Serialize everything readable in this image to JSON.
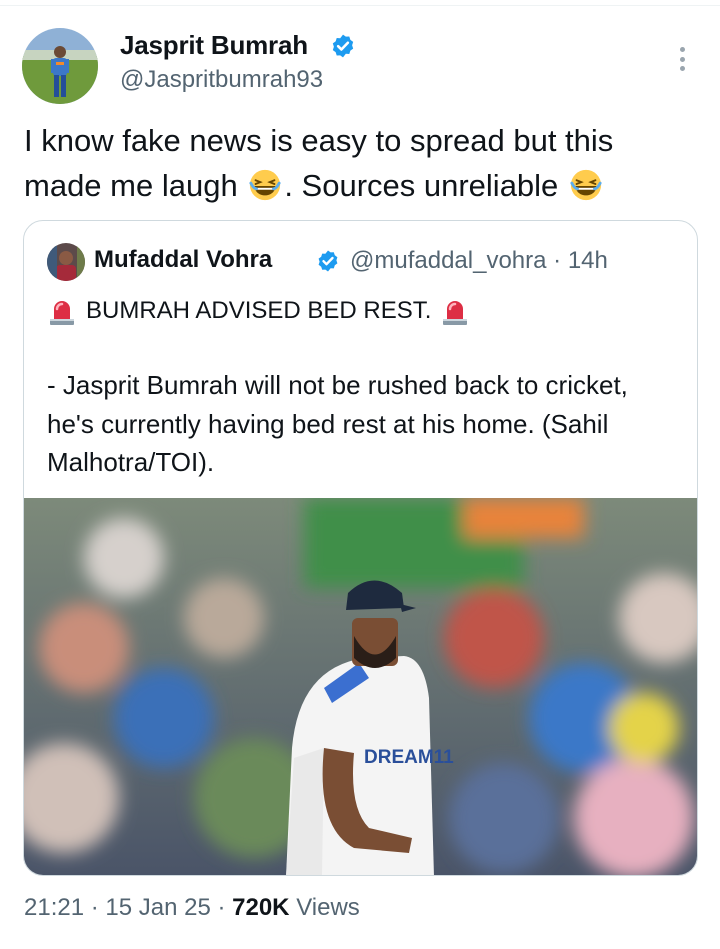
{
  "author": {
    "name": "Jasprit Bumrah",
    "handle": "@Jaspritbumrah93",
    "verified": true,
    "avatar_icon": "profile-photo"
  },
  "tweet": {
    "line1": "I know fake news is easy to spread but this",
    "line2_a": "made me laugh",
    "line2_b": ". Sources unreliable",
    "emoji_icon": "laughing-face-emoji"
  },
  "quote": {
    "name": "Mufaddal Vohra",
    "handle": "@mufaddal_vohra",
    "time": "14h",
    "headline": "BUMRAH ADVISED BED REST.",
    "body": "- Jasprit Bumrah will not be rushed back to cricket, he's currently having bed rest at his home. (Sahil Malhotra/TOI).",
    "image_icon": "cricket-player-photo",
    "image_text": "DREAM11"
  },
  "meta": {
    "time": "21:21",
    "date": "15 Jan 25",
    "views_count": "720K",
    "views_label": "Views"
  },
  "colors": {
    "verified": "#1d9bf0",
    "secondary_text": "#536471",
    "border": "#cfd9de"
  }
}
